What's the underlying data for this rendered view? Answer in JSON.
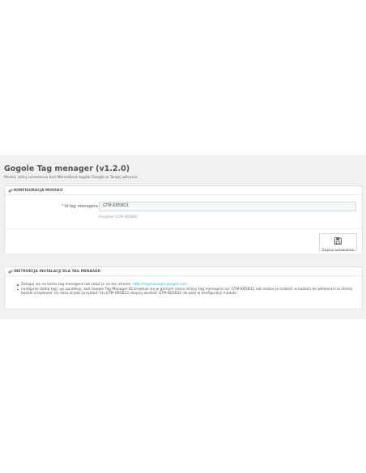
{
  "header": {
    "title": "Gogole Tag menager (v1.2.0)",
    "subtitle": "Moduł, który umieszcza kod Menedżera tagów Google w Twojej witrynie"
  },
  "config_panel": {
    "heading": "KONFIGURACJA MODUŁU",
    "heading_icon": "gears-icon",
    "field": {
      "required_mark": "*",
      "label": "Id tag menagera",
      "value": "GTM-KB5BD1",
      "help": "Przykład: GTM-KB5BD1"
    },
    "save_button": {
      "label": "Zapisz ustawienia",
      "icon": "save-icon"
    }
  },
  "instructions_panel": {
    "heading": "INSTRUKCJA INSTALACJI DLA TAG MENAGER",
    "heading_icon": "gears-icon",
    "items": [
      {
        "text": "Zaloguj się na konto tag menagera lub załuż je na ten stronie: ",
        "link": "http://tagmanager.google.com"
      },
      {
        "text": "następnie dodaj tag i go opublikuj, kod Google Tag Manager ID znajduje się w górnym menu strony tag menagera np: GTM-KB5B12 lub można je znaleźć w kodach do wklejenia na stronę będzie znajdować się nasz id jako przykład: id=GTM-KB5B12 skopiuj wartość GTM-KB5B12 do pola w konfiguracji modułu"
      }
    ]
  },
  "colors": {
    "band_bg": "#eff1f2",
    "link": "#25b9d7",
    "required": "#e05050"
  }
}
